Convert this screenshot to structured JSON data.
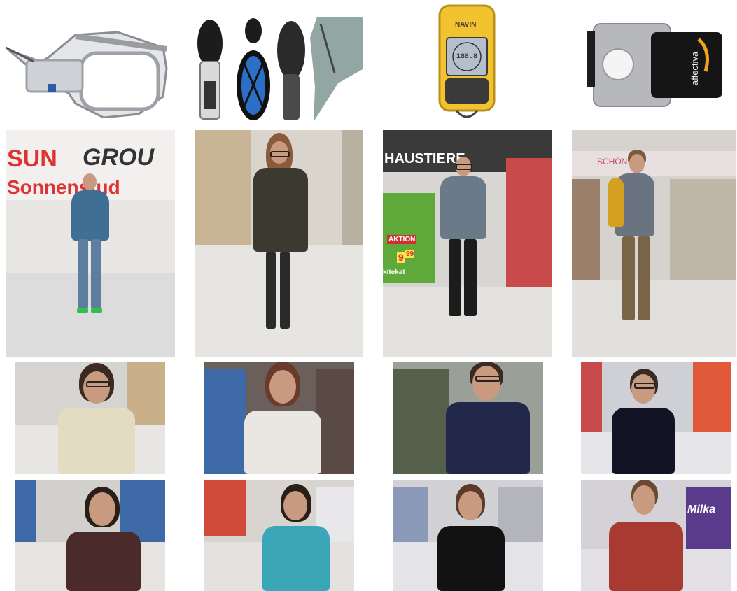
{
  "devices": {
    "navi_brand": "NAVIN",
    "navi_display": "188.8",
    "sensor_brand": "affectiva"
  },
  "signs": {
    "sungroup_line1_a": "SUN",
    "sungroup_line1_b": "GROU",
    "sungroup_line2": "Sonnenstud",
    "haustiere": "HAUSTIERE",
    "aktion": "AKTION",
    "price": "9",
    "price_cents": "99",
    "whiskas": "kitekat",
    "schoen": "SCHÖN",
    "milka": "Milka"
  },
  "colors": {
    "background": "#ffffff",
    "floor": "#e6e6e6",
    "shelf": "#c8c2b8",
    "skin": "#c89a80",
    "navi_yellow": "#f2c230"
  }
}
